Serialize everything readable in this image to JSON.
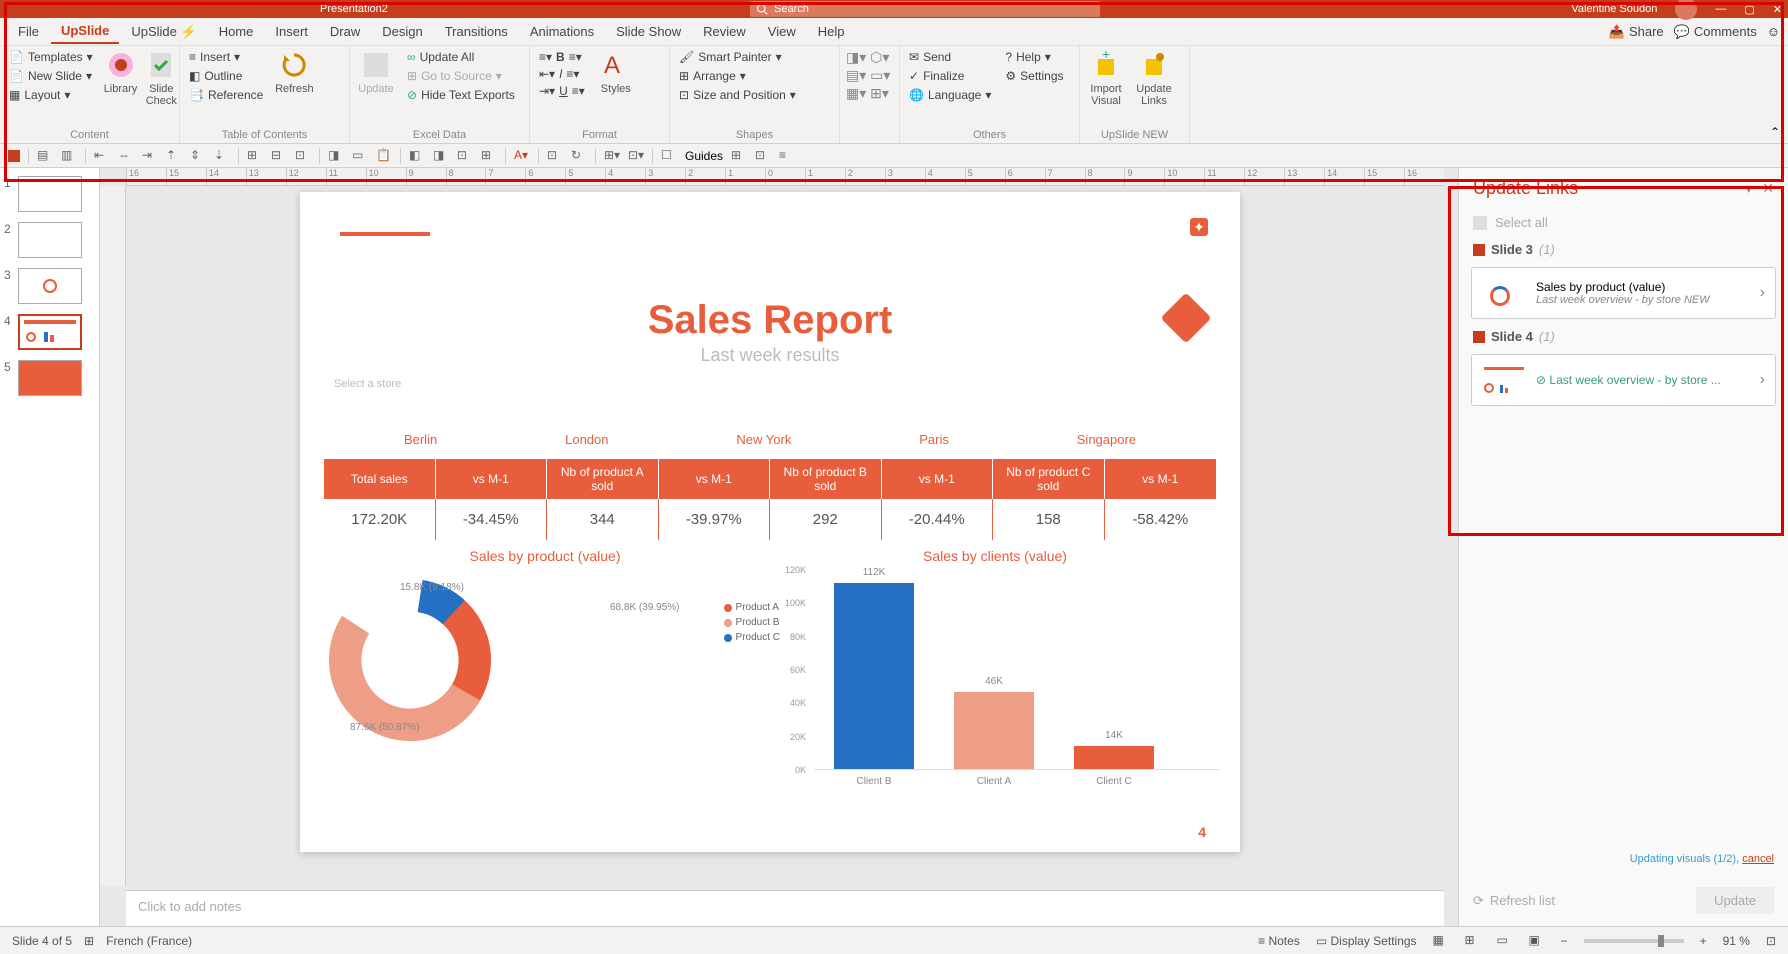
{
  "titlebar": {
    "presentation_name": "Presentation2",
    "search_placeholder": "Search",
    "username": "Valentine Soudon"
  },
  "menu": {
    "items": [
      "File",
      "UpSlide",
      "UpSlide ⚡",
      "Home",
      "Insert",
      "Draw",
      "Design",
      "Transitions",
      "Animations",
      "Slide Show",
      "Review",
      "View",
      "Help"
    ],
    "active": "UpSlide",
    "share": "Share",
    "comments": "Comments"
  },
  "ribbon": {
    "content": {
      "templates": "Templates",
      "newslide": "New Slide",
      "layout": "Layout",
      "library": "Library",
      "slidecheck": "Slide Check",
      "label": "Content"
    },
    "toc": {
      "insert": "Insert",
      "outline": "Outline",
      "reference": "Reference",
      "refresh": "Refresh",
      "label": "Table of Contents"
    },
    "excel": {
      "update": "Update",
      "updateall": "Update All",
      "goto": "Go to Source",
      "hide": "Hide Text Exports",
      "label": "Excel Data"
    },
    "format": {
      "styles": "Styles",
      "label": "Format"
    },
    "shapes": {
      "smart": "Smart Painter",
      "arrange": "Arrange",
      "size": "Size and Position",
      "label": "Shapes"
    },
    "others": {
      "send": "Send",
      "finalize": "Finalize",
      "language": "Language",
      "help": "Help",
      "settings": "Settings",
      "label": "Others"
    },
    "new": {
      "import": "Import Visual",
      "update": "Update Links",
      "label": "UpSlide NEW"
    }
  },
  "qat": {
    "guides": "Guides"
  },
  "thumbs": [
    1,
    2,
    3,
    4,
    5
  ],
  "thumb_selected": 4,
  "slide": {
    "title": "Sales Report",
    "subtitle": "Last week results",
    "select_store": "Select a store",
    "pageno": "4",
    "cities": [
      "Berlin",
      "London",
      "New York",
      "Paris",
      "Singapore"
    ],
    "kpi_headers": [
      "Total sales",
      "vs M-1",
      "Nb of product A sold",
      "vs M-1",
      "Nb of product B sold",
      "vs M-1",
      "Nb of product C sold",
      "vs M-1"
    ],
    "kpi_values": [
      "172.20K",
      "-34.45%",
      "344",
      "-39.97%",
      "292",
      "-20.44%",
      "158",
      "-58.42%"
    ],
    "chart1_title": "Sales by product (value)",
    "chart2_title": "Sales by clients (value)"
  },
  "chart_data": [
    {
      "type": "pie",
      "title": "Sales by product (value)",
      "series": [
        {
          "name": "Product A",
          "value": 68.8,
          "pct": 39.95,
          "color": "#e85d3b"
        },
        {
          "name": "Product B",
          "value": 87.6,
          "pct": 50.87,
          "color": "#ee9e87"
        },
        {
          "name": "Product C",
          "value": 15.8,
          "pct": 9.18,
          "color": "#2670c4"
        }
      ],
      "labels": [
        "68.8K (39.95%)",
        "87.6K (50.87%)",
        "15.8K (9.18%)"
      ]
    },
    {
      "type": "bar",
      "title": "Sales by clients (value)",
      "categories": [
        "Client B",
        "Client A",
        "Client C"
      ],
      "values": [
        112,
        46,
        14
      ],
      "colors": [
        "#2670c4",
        "#ee9e87",
        "#e85d3b"
      ],
      "ylim": [
        0,
        120
      ],
      "yticks": [
        0,
        20,
        40,
        60,
        80,
        100,
        120
      ],
      "ylabel_suffix": "K"
    }
  ],
  "notes": "Click to add notes",
  "panel": {
    "title": "Update Links",
    "select_all": "Select all",
    "groups": [
      {
        "name": "Slide 3",
        "count": "(1)",
        "items": [
          {
            "title": "Sales by product (value)",
            "desc": "Last week overview - by store NEW"
          }
        ]
      },
      {
        "name": "Slide 4",
        "count": "(1)",
        "items": [
          {
            "title": "Last week overview - by store ...",
            "desc": "",
            "ok": true
          }
        ]
      }
    ],
    "updating": "Updating visuals (1/2),",
    "cancel": "cancel",
    "refresh": "Refresh list",
    "update_btn": "Update"
  },
  "status": {
    "slide": "Slide 4 of 5",
    "lang": "French (France)",
    "notes": "Notes",
    "display": "Display Settings",
    "zoom": "91 %"
  }
}
